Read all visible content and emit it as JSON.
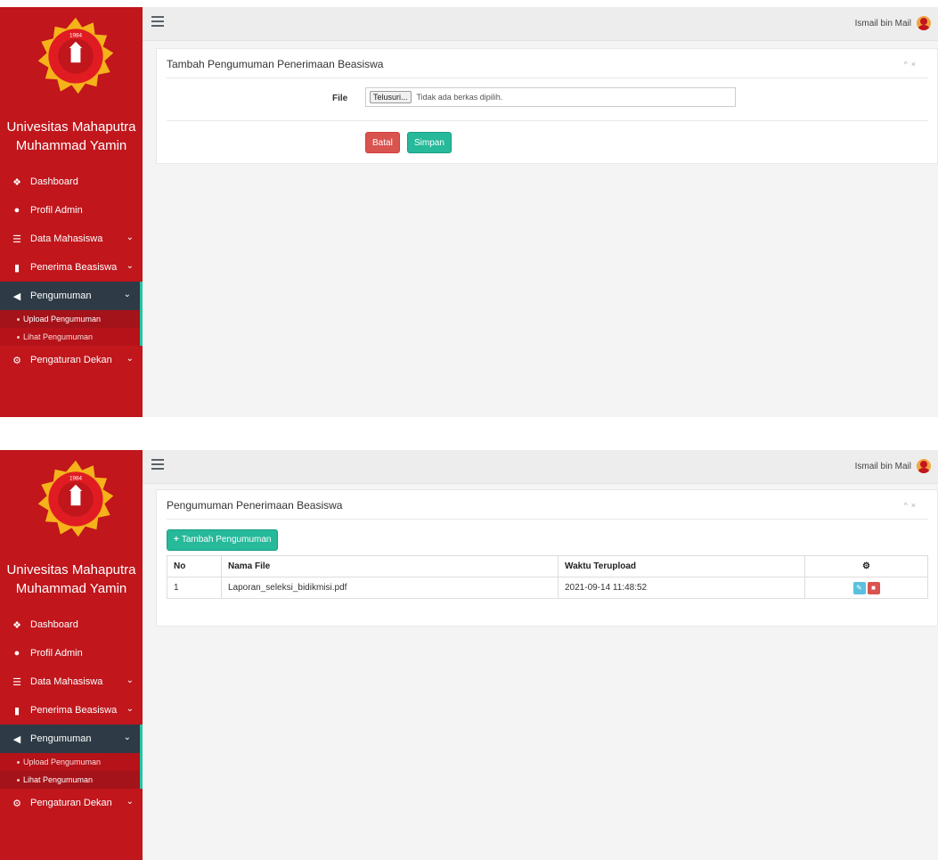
{
  "app": {
    "brand_line1": "Univesitas Mahaputra",
    "brand_line2": "Muhammad Yamin",
    "logo_year": "1984",
    "user_name": "Ismail bin Mail"
  },
  "menu": {
    "dashboard": "Dashboard",
    "profil_admin": "Profil Admin",
    "data_mahasiswa": "Data Mahasiswa",
    "penerima_beasiswa": "Penerima Beasiswa",
    "pengumuman": "Pengumuman",
    "upload_pengumuman": "Upload Pengumuman",
    "lihat_pengumuman": "Lihat Pengumuman",
    "pengaturan_dekan": "Pengaturan Dekan"
  },
  "upload_form": {
    "title": "Tambah Pengumuman Penerimaan Beasiswa",
    "file_label": "File",
    "browse_label": "Telusuri...",
    "no_file_text": "Tidak ada berkas dipilih.",
    "cancel_label": "Batal",
    "save_label": "Simpan"
  },
  "list_page": {
    "title": "Pengumuman Penerimaan Beasiswa",
    "add_label": "Tambah Pengumuman",
    "columns": {
      "no": "No",
      "nama_file": "Nama File",
      "waktu": "Waktu Terupload"
    },
    "rows": [
      {
        "no": "1",
        "nama_file": "Laporan_seleksi_bidikmisi.pdf",
        "waktu": "2021-09-14 11:48:52"
      }
    ]
  },
  "colors": {
    "sidebar": "#c0161c",
    "accent": "#26b99a",
    "danger": "#d9534f",
    "active_menu": "#2e3b46"
  }
}
